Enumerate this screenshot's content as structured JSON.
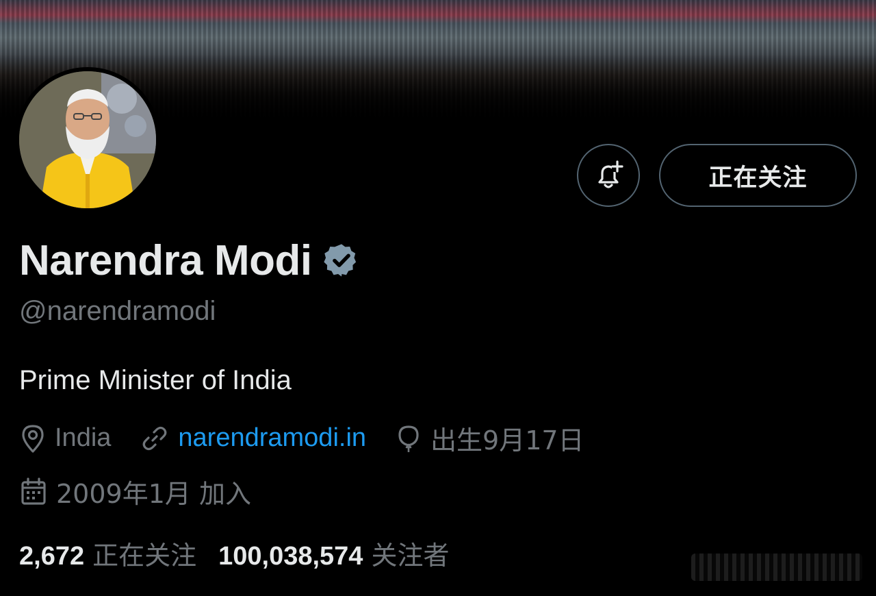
{
  "profile": {
    "display_name": "Narendra Modi",
    "handle": "@narendramodi",
    "bio": "Prime Minister of India",
    "verified": true,
    "verified_color": "#829aab"
  },
  "actions": {
    "notify_icon": "bell-plus-icon",
    "follow_label": "正在关注"
  },
  "meta": {
    "location": "India",
    "website": "narendramodi.in",
    "birthday": "出生9月17日",
    "joined": "2009年1月 加入"
  },
  "stats": {
    "following_count": "2,672",
    "following_label": "正在关注",
    "followers_count": "100,038,574",
    "followers_label": "关注者"
  },
  "colors": {
    "background": "#000000",
    "text_primary": "#e7e9ea",
    "text_secondary": "#71767b",
    "link": "#1d9bf0",
    "border": "#536471",
    "avatar_vest": "#f5c518"
  }
}
